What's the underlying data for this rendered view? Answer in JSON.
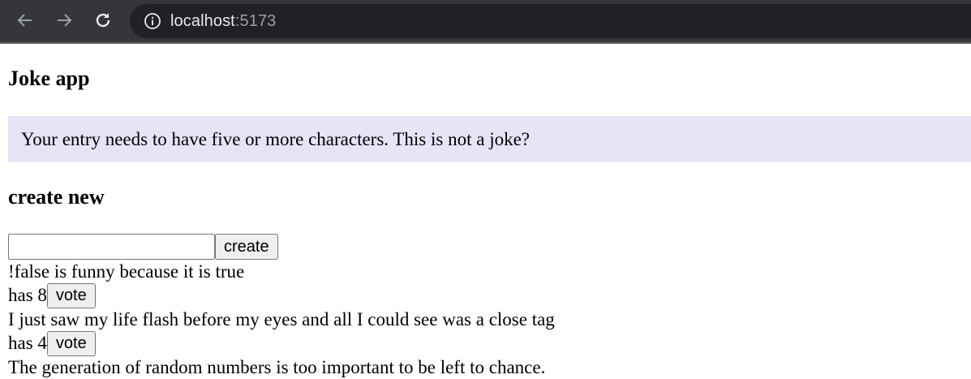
{
  "browser": {
    "url_host": "localhost",
    "url_port": ":5173",
    "icons": {
      "back": "arrow-left-icon",
      "forward": "arrow-right-icon",
      "reload": "reload-icon",
      "info": "info-icon"
    }
  },
  "app": {
    "title": "Joke app",
    "notification": "Your entry needs to have five or more characters. This is not a joke?",
    "create_heading": "create new",
    "create_input_value": "",
    "create_button_label": "create",
    "vote_button_label": "vote",
    "has_label": "has",
    "jokes": [
      {
        "content": "!false is funny because it is true",
        "votes": "8"
      },
      {
        "content": "I just saw my life flash before my eyes and all I could see was a close tag",
        "votes": "4"
      },
      {
        "content": "The generation of random numbers is too important to be left to chance.",
        "votes": ""
      }
    ]
  },
  "colors": {
    "chrome_bg": "#35363a",
    "omnibox_bg": "#202124",
    "notification_bg": "#e6e4f7"
  }
}
